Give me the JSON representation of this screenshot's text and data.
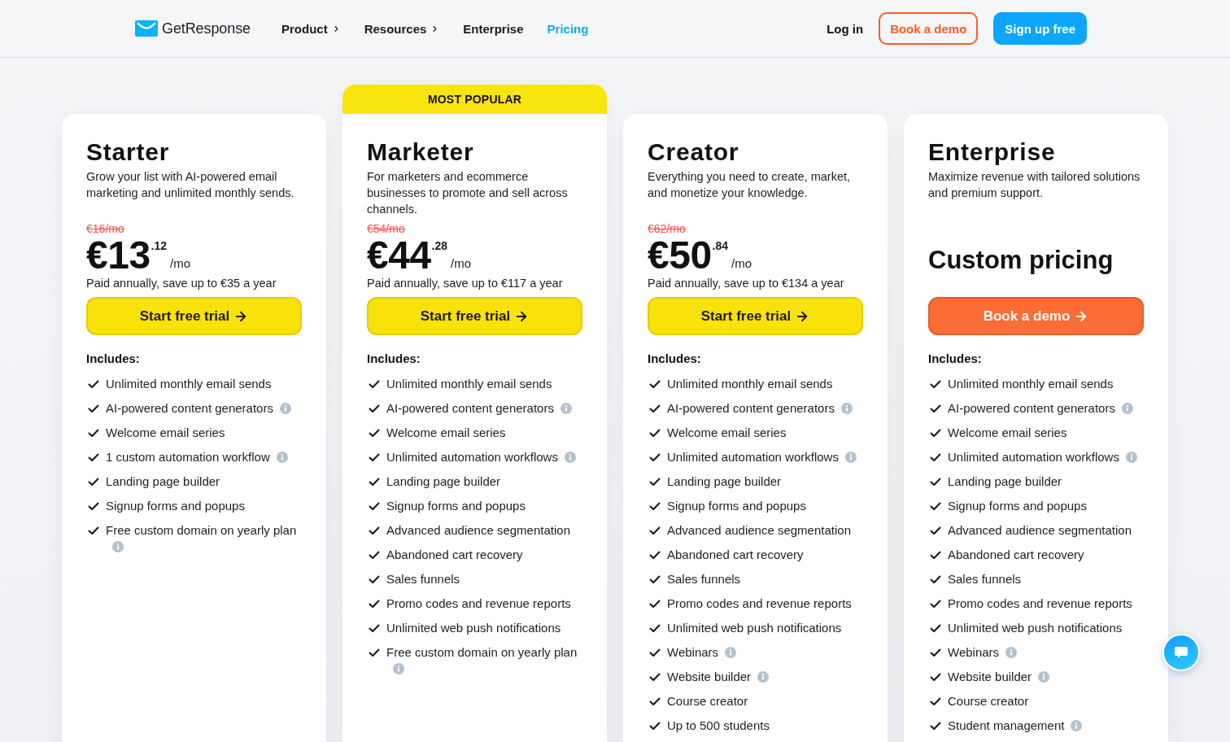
{
  "header": {
    "logo": "GetResponse",
    "nav": [
      {
        "label": "Product",
        "has_submenu": true,
        "selected": false
      },
      {
        "label": "Resources",
        "has_submenu": true,
        "selected": false
      },
      {
        "label": "Enterprise",
        "has_submenu": false,
        "selected": false
      },
      {
        "label": "Pricing",
        "has_submenu": false,
        "selected": true
      }
    ],
    "login": "Log in",
    "actions": [
      {
        "label": "Book a demo",
        "kind": "outline"
      },
      {
        "label": "Sign up free",
        "kind": "solid"
      }
    ]
  },
  "plans": [
    {
      "name": "Starter",
      "description": "Grow your list with AI-powered email marketing and unlimited monthly sends.",
      "old_price": "€16/mo",
      "price": "€13",
      "cents": ".12",
      "period": "/mo",
      "note": "Paid annually, save up to €35 a year",
      "cta": {
        "label": "Start free trial",
        "kind": "trial"
      },
      "includes_label": "Includes:",
      "features": [
        {
          "text": "Unlimited monthly email sends",
          "info": false
        },
        {
          "text": "AI-powered content generators",
          "info": true
        },
        {
          "text": "Welcome email series",
          "info": false
        },
        {
          "text": "1 custom automation workflow",
          "info": true
        },
        {
          "text": "Landing page builder",
          "info": false
        },
        {
          "text": "Signup forms and popups",
          "info": false
        },
        {
          "text": "Free custom domain on yearly plan",
          "info": true
        }
      ]
    },
    {
      "badge": "MOST POPULAR",
      "name": "Marketer",
      "description": "For marketers and ecommerce businesses to promote and sell across channels.",
      "old_price": "€54/mo",
      "price": "€44",
      "cents": ".28",
      "period": "/mo",
      "note": "Paid annually, save up to €117 a year",
      "cta": {
        "label": "Start free trial",
        "kind": "trial"
      },
      "includes_label": "Includes:",
      "features": [
        {
          "text": "Unlimited monthly email sends",
          "info": false
        },
        {
          "text": "AI-powered content generators",
          "info": true
        },
        {
          "text": "Welcome email series",
          "info": false
        },
        {
          "text": "Unlimited automation workflows",
          "info": true
        },
        {
          "text": "Landing page builder",
          "info": false
        },
        {
          "text": "Signup forms and popups",
          "info": false
        },
        {
          "text": "Advanced audience segmentation",
          "info": false
        },
        {
          "text": "Abandoned cart recovery",
          "info": false
        },
        {
          "text": "Sales funnels",
          "info": false
        },
        {
          "text": "Promo codes and revenue reports",
          "info": false
        },
        {
          "text": "Unlimited web push notifications",
          "info": false
        },
        {
          "text": "Free custom domain on yearly plan",
          "info": true
        }
      ]
    },
    {
      "name": "Creator",
      "description": "Everything you need to create, market, and monetize your knowledge.",
      "old_price": "€62/mo",
      "price": "€50",
      "cents": ".84",
      "period": "/mo",
      "note": "Paid annually, save up to €134 a year",
      "cta": {
        "label": "Start free trial",
        "kind": "trial"
      },
      "includes_label": "Includes:",
      "features": [
        {
          "text": "Unlimited monthly email sends",
          "info": false
        },
        {
          "text": "AI-powered content generators",
          "info": true
        },
        {
          "text": "Welcome email series",
          "info": false
        },
        {
          "text": "Unlimited automation workflows",
          "info": true
        },
        {
          "text": "Landing page builder",
          "info": false
        },
        {
          "text": "Signup forms and popups",
          "info": false
        },
        {
          "text": "Advanced audience segmentation",
          "info": false
        },
        {
          "text": "Abandoned cart recovery",
          "info": false
        },
        {
          "text": "Sales funnels",
          "info": false
        },
        {
          "text": "Promo codes and revenue reports",
          "info": false
        },
        {
          "text": "Unlimited web push notifications",
          "info": false
        },
        {
          "text": "Webinars",
          "info": true
        },
        {
          "text": "Website builder",
          "info": true
        },
        {
          "text": "Course creator",
          "info": false
        },
        {
          "text": "Up to 500 students",
          "info": false
        }
      ]
    },
    {
      "name": "Enterprise",
      "description": "Maximize revenue with tailored solutions and premium support.",
      "custom_price": "Custom pricing",
      "cta": {
        "label": "Book a demo",
        "kind": "demo"
      },
      "includes_label": "Includes:",
      "features": [
        {
          "text": "Unlimited monthly email sends",
          "info": false
        },
        {
          "text": "AI-powered content generators",
          "info": true
        },
        {
          "text": "Welcome email series",
          "info": false
        },
        {
          "text": "Unlimited automation workflows",
          "info": true
        },
        {
          "text": "Landing page builder",
          "info": false
        },
        {
          "text": "Signup forms and popups",
          "info": false
        },
        {
          "text": "Advanced audience segmentation",
          "info": false
        },
        {
          "text": "Abandoned cart recovery",
          "info": false
        },
        {
          "text": "Sales funnels",
          "info": false
        },
        {
          "text": "Promo codes and revenue reports",
          "info": false
        },
        {
          "text": "Unlimited web push notifications",
          "info": false
        },
        {
          "text": "Webinars",
          "info": true
        },
        {
          "text": "Website builder",
          "info": true
        },
        {
          "text": "Course creator",
          "info": false
        },
        {
          "text": "Student management",
          "info": true
        }
      ]
    }
  ]
}
